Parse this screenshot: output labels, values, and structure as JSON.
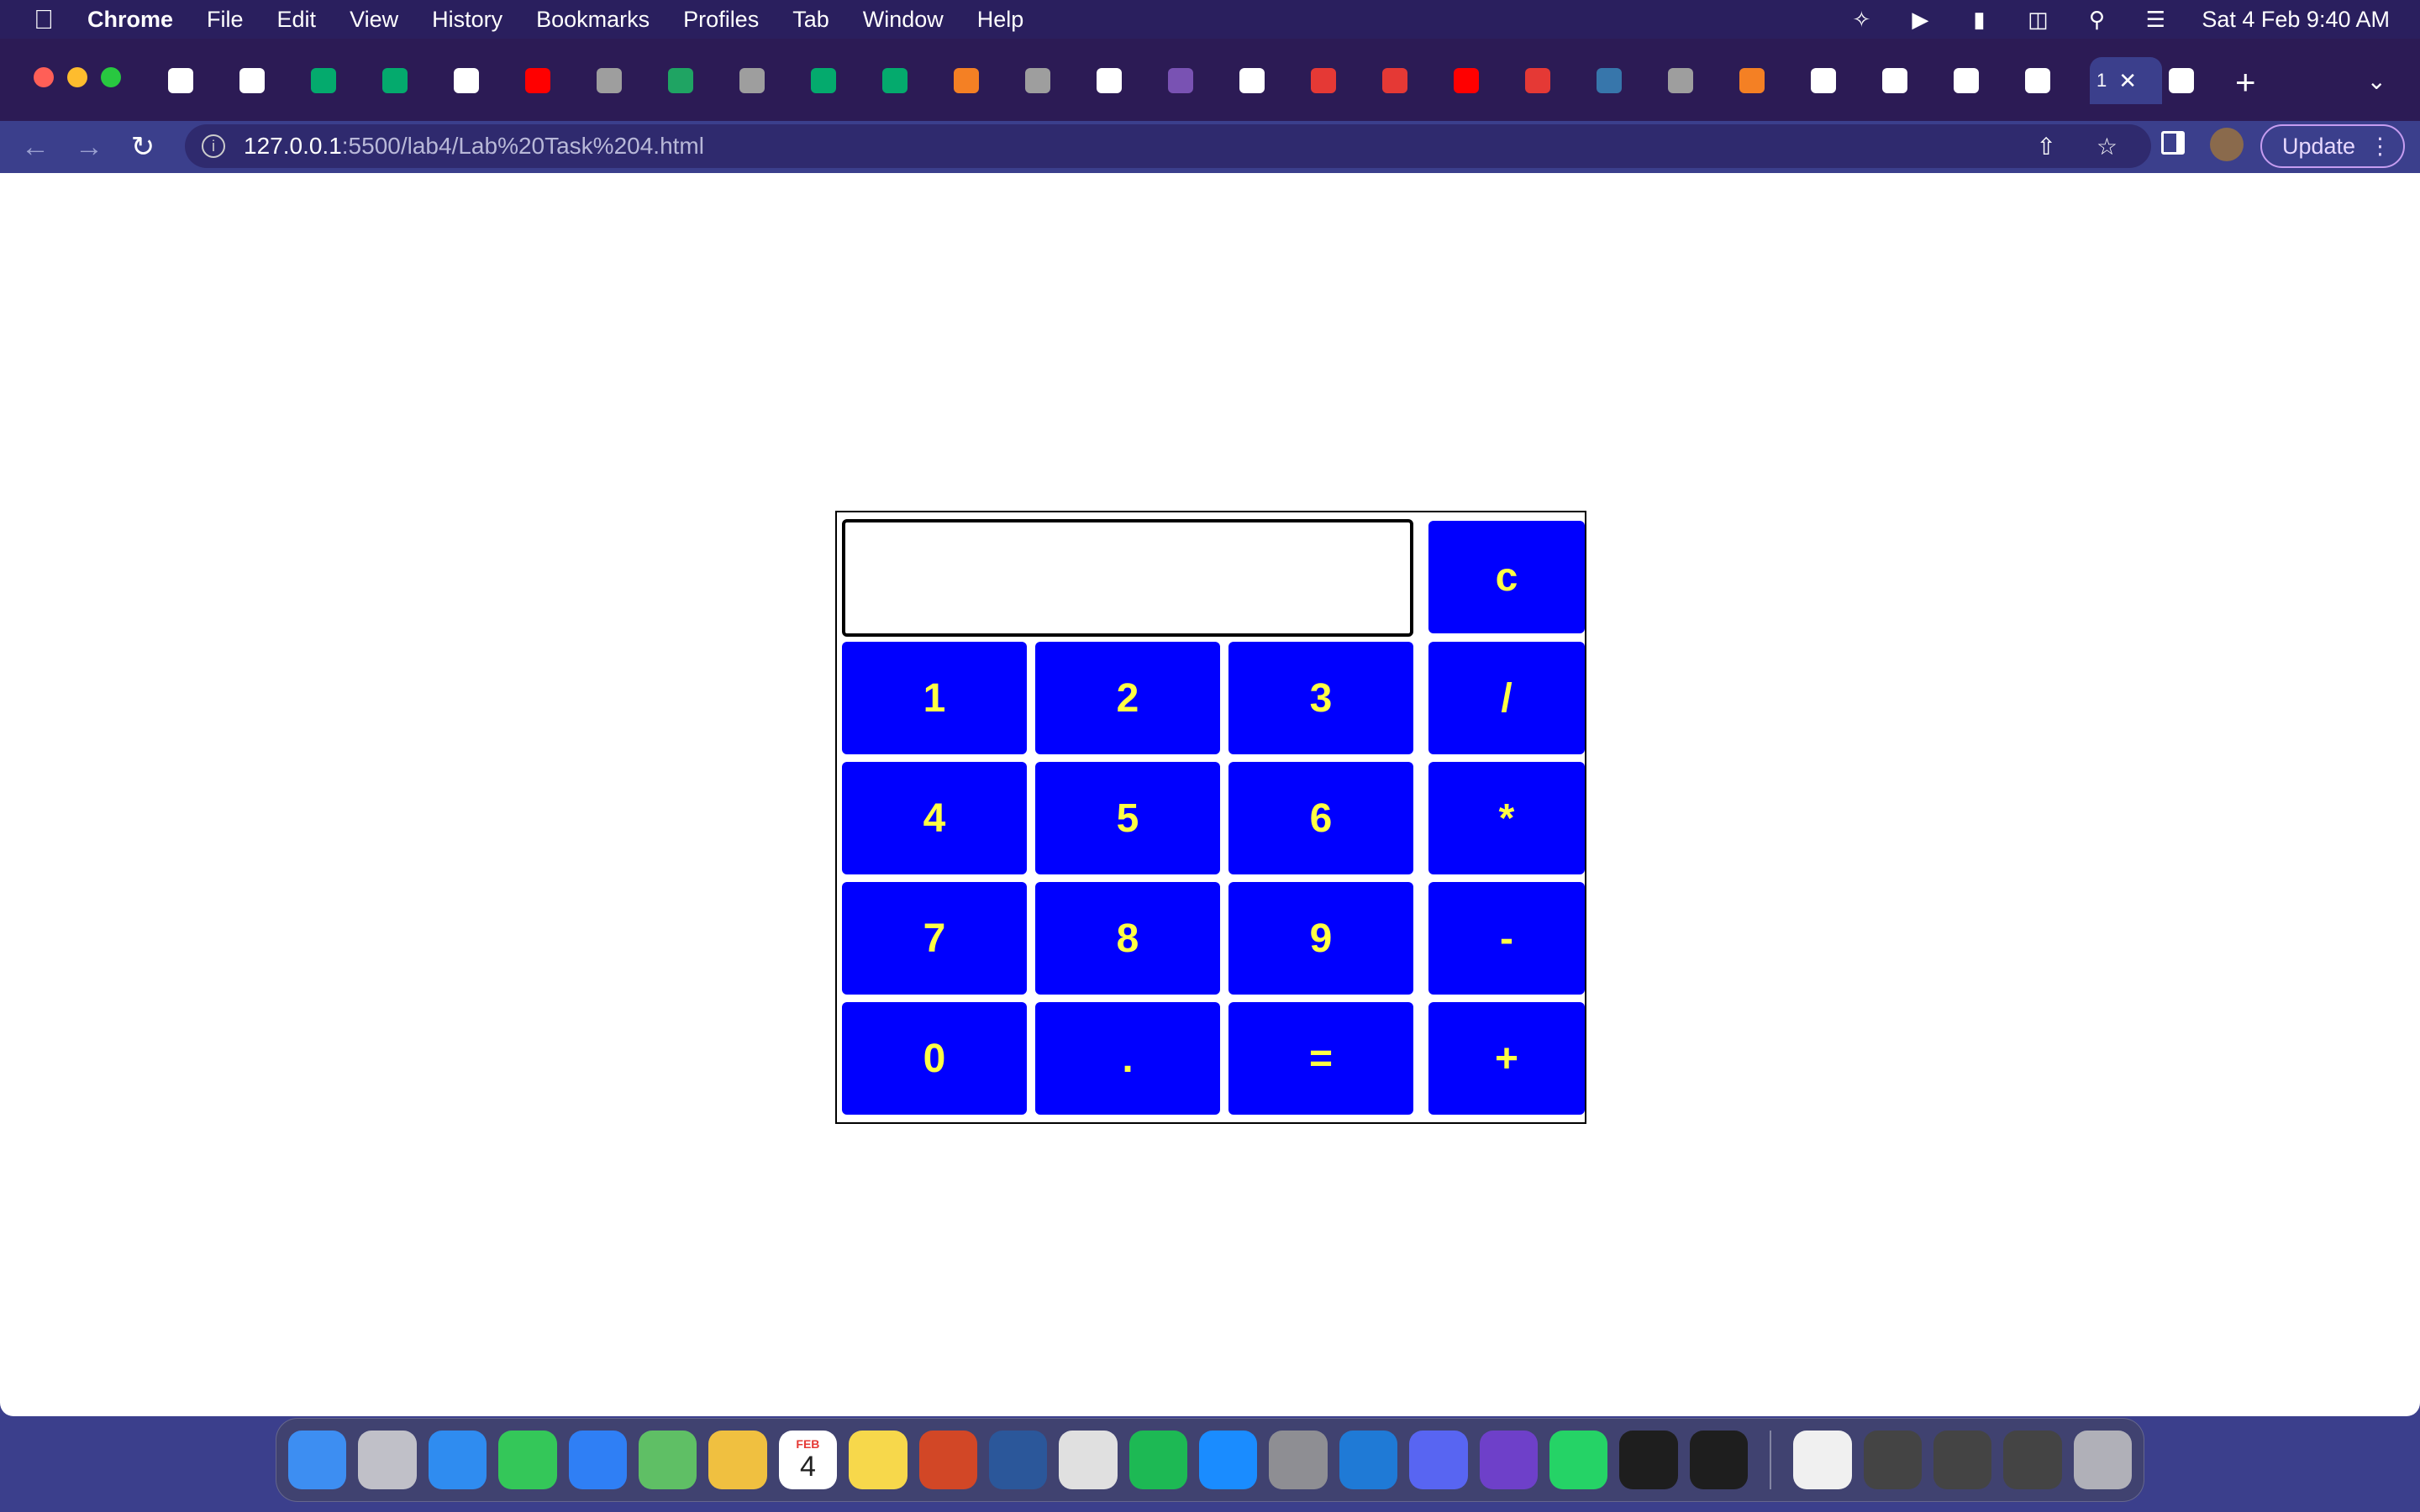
{
  "menubar": {
    "app": "Chrome",
    "items": [
      "File",
      "Edit",
      "View",
      "History",
      "Bookmarks",
      "Profiles",
      "Tab",
      "Window",
      "Help"
    ],
    "clock": "Sat 4 Feb  9:40 AM"
  },
  "tabs": {
    "active_label": "1",
    "favicons": [
      "codepen-icon",
      "codepen-icon",
      "w3schools-icon",
      "w3schools-icon",
      "google-icon",
      "youtube-icon",
      "globe-icon",
      "drive-icon",
      "globe-icon",
      "w3schools-icon",
      "w3schools-icon",
      "stackoverflow-icon",
      "globe-icon",
      "google-icon",
      "bootstrap-icon",
      "github-icon",
      "app-icon",
      "app-icon",
      "youtube-icon",
      "app-icon",
      "python-icon",
      "globe-icon",
      "stackoverflow-icon",
      "google-icon",
      "github-icon",
      "chrome-icon",
      "gmail-icon",
      "google-icon"
    ]
  },
  "address_bar": {
    "host": "127.0.0.1",
    "path": ":5500/lab4/Lab%20Task%204.html"
  },
  "toolbar": {
    "update_label": "Update"
  },
  "calculator": {
    "display_value": "",
    "clear_label": "c",
    "keys": [
      "1",
      "2",
      "3",
      "/",
      "4",
      "5",
      "6",
      "*",
      "7",
      "8",
      "9",
      "-",
      "0",
      ".",
      "=",
      "+"
    ]
  },
  "dock": {
    "apps": [
      "finder",
      "launchpad",
      "safari",
      "messages",
      "mail",
      "maps",
      "photos",
      "calendar",
      "notes",
      "powerpoint",
      "word",
      "chrome",
      "spotify",
      "app-store",
      "system-settings",
      "vscode",
      "discord",
      "github-desktop",
      "whatsapp",
      "terminal",
      "terminal",
      "html-file",
      "window-thumbnail",
      "window-thumbnail",
      "window-thumbnail",
      "trash"
    ],
    "calendar_month": "FEB",
    "calendar_day": "4"
  },
  "colors": {
    "key_bg": "#0000ff",
    "key_text": "#ffff44",
    "chrome_frame": "#2c1b55",
    "toolbar": "#3b3f8c"
  }
}
